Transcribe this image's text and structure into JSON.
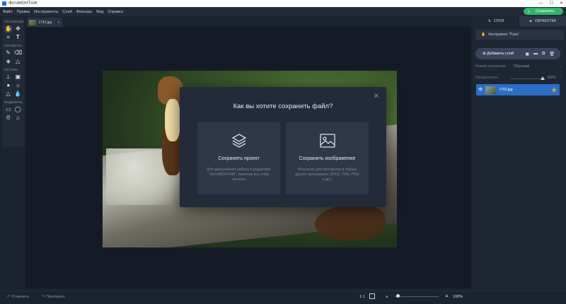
{
  "window": {
    "title": "ФотоМОНТАЖ",
    "controls": [
      "—",
      "☐",
      "✕"
    ]
  },
  "menu": [
    "Файл",
    "Правка",
    "Инструменты",
    "Слой",
    "Фильтры",
    "Вид",
    "Справка"
  ],
  "save_button": "Сохранить",
  "tools": {
    "sections": [
      "ОСНОВНЫЕ",
      "РИСОВАТЬ",
      "РЕТУШЬ",
      "ВЫДЕЛИТЬ"
    ]
  },
  "tab": {
    "filename": "1742.jpg"
  },
  "dialog": {
    "title": "Как вы хотите сохранить файл?",
    "options": [
      {
        "title": "Сохранить проект",
        "desc": "Для дальнейшей работы в редакторе \"ФотоМОНТАЖ\", включая все слои проекта",
        "icon": "layers-icon"
      },
      {
        "title": "Сохранить изображение",
        "desc": "Результат для просмотра в любых других программах (JPEG, TIFF, PNG и др.)",
        "icon": "image-icon"
      }
    ]
  },
  "bottom": {
    "undo": "Отменить",
    "redo": "Повторить",
    "ratio": "1:1",
    "zoom": "100%",
    "zoom_level": 0.05
  },
  "right_panel": {
    "tabs": [
      "СЛОИ",
      "ОБРАБОТКА"
    ],
    "instrument": "Инструмент \"Рука\"",
    "add_layer": "Добавить слой",
    "blend_label": "Режим наложения:",
    "blend_value": "Обычный",
    "opacity_label": "Прозрачность",
    "opacity_value": "100%",
    "layer_name": "1742.jpg"
  }
}
